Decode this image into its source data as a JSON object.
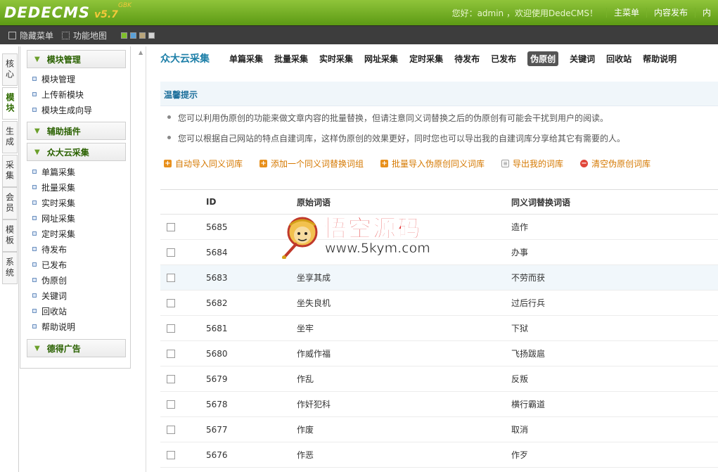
{
  "header": {
    "logo": "DEDECMS",
    "version": "v5.7",
    "version_sup": "GBK",
    "welcome": "您好：admin ，欢迎使用DedeCMS！",
    "links": [
      "主菜单",
      "内容发布",
      "内"
    ]
  },
  "toolbar": {
    "hide_menu": "隐藏菜单",
    "site_map": "功能地图",
    "skin_colors": [
      "#7fbf2a",
      "#5aa0d8",
      "#b9a57a",
      "#d4d4d4"
    ]
  },
  "vtabs": [
    {
      "label": "核心",
      "active": false
    },
    {
      "label": "模块",
      "active": true
    },
    {
      "label": "生成",
      "active": false
    },
    {
      "label": "采集",
      "active": false
    },
    {
      "label": "会员",
      "active": false
    },
    {
      "label": "模板",
      "active": false
    },
    {
      "label": "系统",
      "active": false
    }
  ],
  "sidemenu": {
    "group1": {
      "title": "模块管理",
      "items": [
        "模块管理",
        "上传新模块",
        "模块生成向导"
      ]
    },
    "group2": {
      "title": "辅助插件"
    },
    "group3": {
      "title": "众大云采集",
      "items": [
        "单篇采集",
        "批量采集",
        "实时采集",
        "网址采集",
        "定时采集",
        "待发布",
        "已发布",
        "伪原创",
        "关键词",
        "回收站",
        "帮助说明"
      ]
    },
    "group4": {
      "title": "德得广告"
    }
  },
  "nav": {
    "title": "众大云采集",
    "links": [
      "单篇采集",
      "批量采集",
      "实时采集",
      "网址采集",
      "定时采集",
      "待发布",
      "已发布",
      "伪原创",
      "关键词",
      "回收站",
      "帮助说明"
    ],
    "active_index": 7
  },
  "tips": {
    "title": "温馨提示",
    "lines": [
      "您可以利用伪原创的功能来做文章内容的批量替换，但请注意同义词替换之后的伪原创有可能会干扰到用户的阅读。",
      "您可以根据自己网站的特点自建词库，这样伪原创的效果更好，同时您也可以导出我的自建词库分享给其它有需要的人。"
    ]
  },
  "actions": [
    {
      "label": "自动导入同义词库",
      "icon": "plus-icon",
      "color": "#e8901c"
    },
    {
      "label": "添加一个同义词替换词组",
      "icon": "plus-icon",
      "color": "#e8901c"
    },
    {
      "label": "批量导入伪原创同义词库",
      "icon": "plus-icon",
      "color": "#e8901c"
    },
    {
      "label": "导出我的词库",
      "icon": "document-icon",
      "color": "#9a9a9a"
    },
    {
      "label": "清空伪原创词库",
      "icon": "minus-icon",
      "color": "#e0463a"
    }
  ],
  "table": {
    "headers": [
      "",
      "ID",
      "原始词语",
      "同义词替换词语"
    ],
    "rows": [
      {
        "id": "5685",
        "src": "",
        "dst": "造作"
      },
      {
        "id": "5684",
        "src": "",
        "dst": "办事"
      },
      {
        "id": "5683",
        "src": "坐享其成",
        "dst": "不劳而获"
      },
      {
        "id": "5682",
        "src": "坐失良机",
        "dst": "过后行兵"
      },
      {
        "id": "5681",
        "src": "坐牢",
        "dst": "下狱"
      },
      {
        "id": "5680",
        "src": "作威作福",
        "dst": "飞扬跋扈"
      },
      {
        "id": "5679",
        "src": "作乱",
        "dst": "反叛"
      },
      {
        "id": "5678",
        "src": "作奸犯科",
        "dst": "横行霸道"
      },
      {
        "id": "5677",
        "src": "作废",
        "dst": "取消"
      },
      {
        "id": "5676",
        "src": "作恶",
        "dst": "作歹"
      }
    ],
    "highlight_index": 2
  },
  "watermark": {
    "title": "悟空源码",
    "url": "www.5kym.com"
  }
}
